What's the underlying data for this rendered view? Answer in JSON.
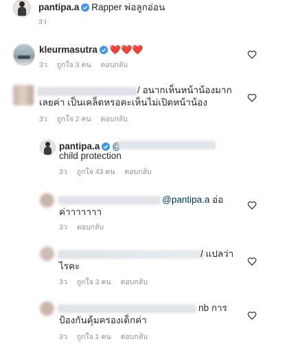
{
  "post": {
    "username": "pantipa.a",
    "caption": "Rapper พ่อลูกอ่อน",
    "time": "3ว"
  },
  "comments": [
    {
      "username": "kleurmasutra",
      "emoji": "❤️❤️❤️",
      "time": "3ว",
      "likes": "ถูกใจ 3 คน",
      "reply": "ตอบกลับ"
    },
    {
      "text_line1": "/ อนากเห็นหน้าน้องมาก",
      "text_line2": "เลยค่า เป็นเคล็ดหรอคะเห็นไม่เปิดหน้าน้อง",
      "time": "3ว",
      "likes": "ถูกใจ 2 คน",
      "reply": "ตอบกลับ"
    },
    {
      "username": "pantipa.a",
      "mention": "@",
      "text": "child protection",
      "time": "3ว",
      "likes": "ถูกใจ 43 คน",
      "reply": "ตอบกลับ"
    },
    {
      "mention": "@pantipa.a",
      "text_tail": "อ่อ",
      "text_line2": "ค่าาาาาาา",
      "time": "3ว",
      "reply": "ตอบกลับ"
    },
    {
      "text_tail": "/ แปลว่า",
      "text_line2": "ไรคะ",
      "time": "3ว",
      "likes": "ถูกใจ 3 คน",
      "reply": "ตอบกลับ"
    },
    {
      "text_tail": "nb การ",
      "text_line2": "ป้องกันคุ้มครองเด็กค่า",
      "time": "3ว",
      "likes": "ถูกใจ 1 คน",
      "reply": "ตอบกลับ"
    }
  ],
  "colors": {
    "verified": "#3897f0",
    "heart_outline": "#262626",
    "meta": "#8e8e8e"
  }
}
